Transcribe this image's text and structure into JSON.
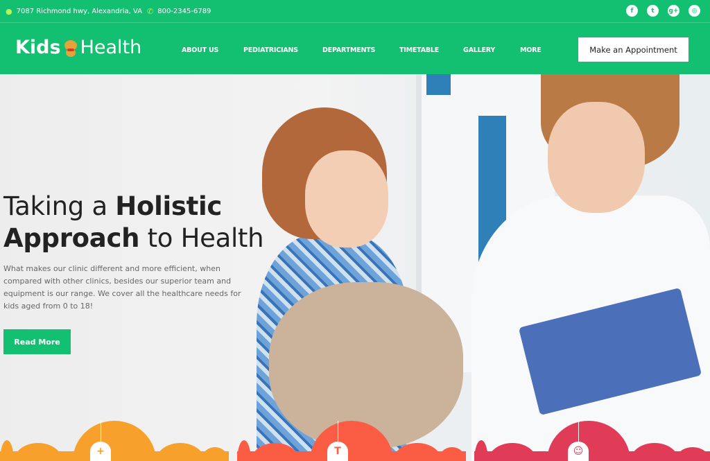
{
  "topbar": {
    "address": "7087 Richmond hwy, Alexandria, VA",
    "phone": "800-2345-6789",
    "social": [
      {
        "icon": "facebook-icon",
        "glyph": "f"
      },
      {
        "icon": "twitter-icon",
        "glyph": "t"
      },
      {
        "icon": "google-plus-icon",
        "glyph": "g+"
      },
      {
        "icon": "instagram-icon",
        "glyph": "◎"
      }
    ]
  },
  "logo": {
    "kids": "Kids",
    "health": "Health"
  },
  "nav": {
    "items": [
      "ABOUT US",
      "PEDIATRICIANS",
      "DEPARTMENTS",
      "TIMETABLE",
      "GALLERY",
      "MORE"
    ],
    "cta": "Make an Appointment"
  },
  "hero": {
    "title_light1": "Taking a ",
    "title_bold1": "Holistic",
    "title_bold2": "Approach",
    "title_light2": " to Health",
    "description": "What makes our clinic different and more efficient, when compared with other clinics, besides our superior team and equipment is our range. We cover all the healthcare needs for kids aged from 0 to 18!",
    "button": "Read More"
  },
  "features": [
    {
      "icon": "medical-kit-icon",
      "glyph": "+",
      "color": "#f7a02b"
    },
    {
      "icon": "person-icon",
      "glyph": "T",
      "color": "#fb5d44"
    },
    {
      "icon": "smile-icon",
      "glyph": "☺",
      "color": "#e13c57"
    }
  ],
  "colors": {
    "brand": "#13bf70",
    "accent_pin": "#b7f55a"
  }
}
